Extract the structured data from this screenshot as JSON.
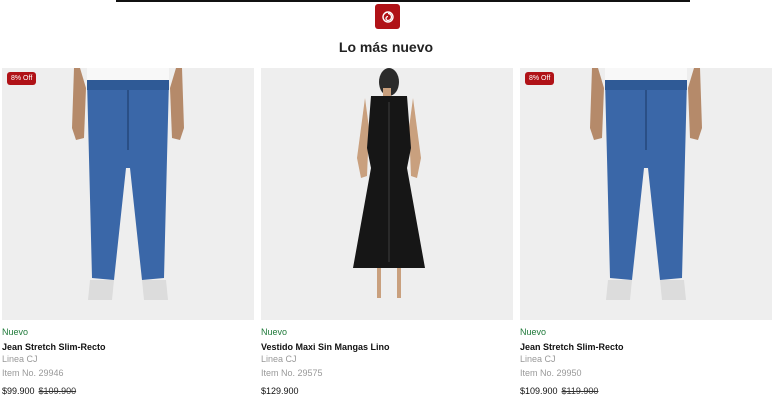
{
  "header": {
    "logo_icon": "brand-logo-icon",
    "section_title": "Lo más nuevo"
  },
  "colors": {
    "brand_red": "#b01217",
    "new_green": "#1f7a3a",
    "image_bg": "#eeeeee"
  },
  "products": [
    {
      "badge": "8% Off",
      "tag": "Nuevo",
      "name": "Jean Stretch Slim-Recto",
      "brand": "Linea CJ",
      "item": "Item No. 29946",
      "price": "$99.900",
      "old_price": "$109.900",
      "image": "blue-jeans-photo"
    },
    {
      "badge": "",
      "tag": "Nuevo",
      "name": "Vestido Maxi Sin Mangas Lino",
      "brand": "Linea CJ",
      "item": "Item No. 29575",
      "price": "$129.900",
      "old_price": "",
      "image": "black-dress-photo"
    },
    {
      "badge": "8% Off",
      "tag": "Nuevo",
      "name": "Jean Stretch Slim-Recto",
      "brand": "Linea CJ",
      "item": "Item No. 29950",
      "price": "$109.900",
      "old_price": "$119.900",
      "image": "blue-jeans-photo"
    }
  ]
}
